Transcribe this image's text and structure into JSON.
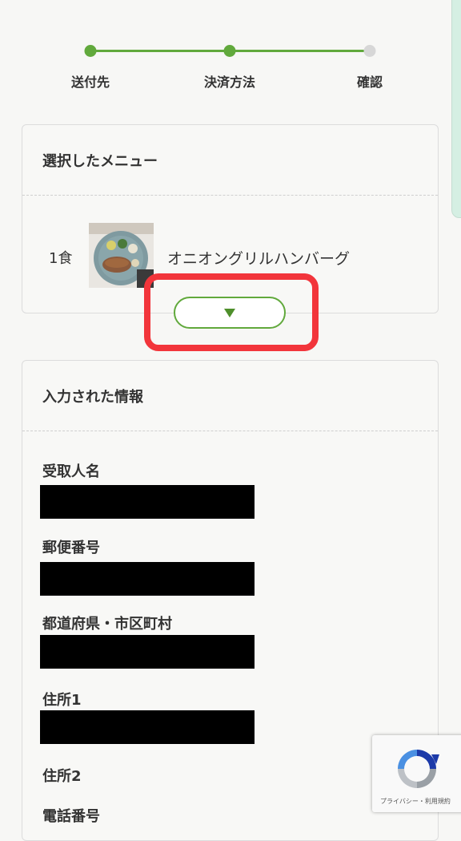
{
  "stepper": {
    "steps": [
      {
        "label": "送付先",
        "state": "done"
      },
      {
        "label": "決済方法",
        "state": "done"
      },
      {
        "label": "確認",
        "state": "todo"
      }
    ]
  },
  "menu_section": {
    "title": "選択したメニュー",
    "items": [
      {
        "quantity": "1食",
        "name": "オニオングリルハンバーグ"
      }
    ],
    "expand_icon": "triangle-down-icon"
  },
  "info_section": {
    "title": "入力された情報",
    "fields": [
      {
        "label": "受取人名"
      },
      {
        "label": "郵便番号"
      },
      {
        "label": "都道府県・市区町村"
      },
      {
        "label": "住所1"
      },
      {
        "label": "住所2"
      },
      {
        "label": "電話番号"
      }
    ]
  },
  "recaptcha": {
    "links": "プライバシー・利用規約"
  },
  "colors": {
    "accent": "#61a93c",
    "highlight": "#f2353b",
    "inactive": "#d7d7d7"
  }
}
